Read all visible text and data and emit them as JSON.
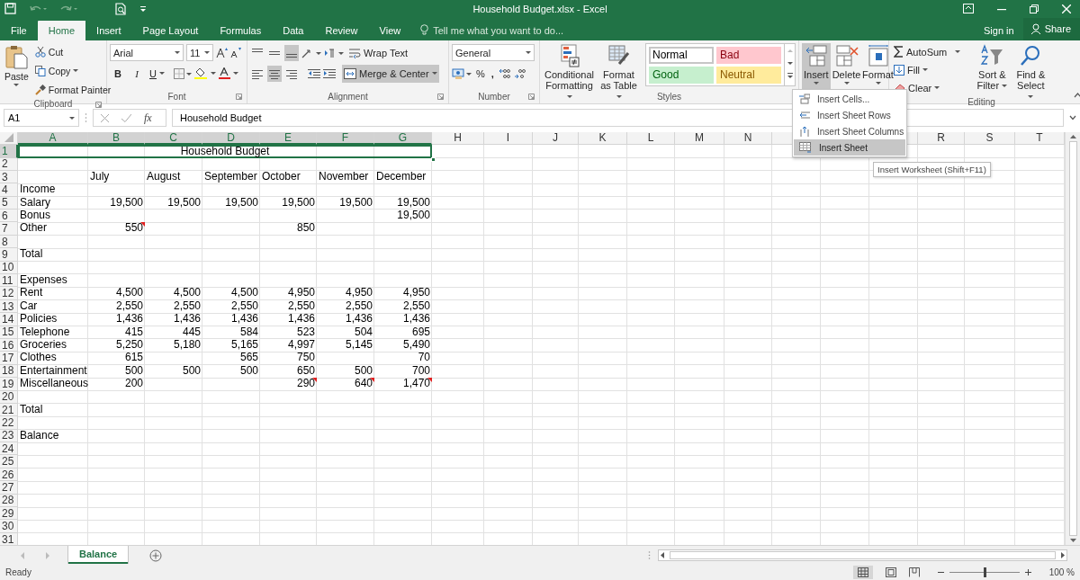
{
  "window": {
    "title": "Household Budget.xlsx - Excel"
  },
  "tabs": [
    {
      "label": "File",
      "selected": false
    },
    {
      "label": "Home",
      "selected": true
    },
    {
      "label": "Insert",
      "selected": false
    },
    {
      "label": "Page Layout",
      "selected": false
    },
    {
      "label": "Formulas",
      "selected": false
    },
    {
      "label": "Data",
      "selected": false
    },
    {
      "label": "Review",
      "selected": false
    },
    {
      "label": "View",
      "selected": false
    }
  ],
  "tell_me": {
    "placeholder": "Tell me what you want to do..."
  },
  "account": {
    "sign_in": "Sign in",
    "share": "Share"
  },
  "ribbon": {
    "clipboard": {
      "paste": "Paste",
      "cut": "Cut",
      "copy": "Copy",
      "format_painter": "Format Painter",
      "label": "Clipboard"
    },
    "font": {
      "name": "Arial",
      "size": "11",
      "bold": "B",
      "italic": "I",
      "underline": "U",
      "label": "Font"
    },
    "alignment": {
      "wrap_text": "Wrap Text",
      "merge_center": "Merge & Center",
      "label": "Alignment"
    },
    "number": {
      "format": "General",
      "percent": "%",
      "comma": ",",
      "label": "Number"
    },
    "styles": {
      "conditional_formatting": "Conditional Formatting",
      "format_as_table": "Format as Table",
      "cell_styles": [
        {
          "name": "Normal",
          "color": "#ffffff"
        },
        {
          "name": "Bad",
          "color": "#ffc7ce"
        },
        {
          "name": "Good",
          "color": "#c6efce"
        },
        {
          "name": "Neutral",
          "color": "#ffeb9c"
        }
      ],
      "label": "Styles"
    },
    "cells": {
      "buttons": [
        {
          "label": "Insert",
          "selected": true
        },
        {
          "label": "Delete",
          "selected": false
        },
        {
          "label": "Format",
          "selected": false
        }
      ]
    },
    "editing": {
      "autosum": "AutoSum",
      "fill": "Fill",
      "clear": "Clear",
      "sort_filter": "Sort & Filter",
      "find_select": "Find & Select",
      "label": "Editing"
    }
  },
  "formula_bar": {
    "name_box": "A1",
    "fx": "fx",
    "formula": "Household Budget"
  },
  "insert_menu": {
    "items": [
      {
        "label": "Insert Cells...",
        "selected": false
      },
      {
        "label": "Insert Sheet Rows",
        "selected": false
      },
      {
        "label": "Insert Sheet Columns",
        "selected": false
      },
      {
        "label": "Insert Sheet",
        "selected": true
      }
    ]
  },
  "tooltip": "Insert Worksheet (Shift+F11)",
  "grid": {
    "columns": [
      {
        "label": "A",
        "selected": true
      },
      {
        "label": "B",
        "selected": true
      },
      {
        "label": "C",
        "selected": true
      },
      {
        "label": "D",
        "selected": true
      },
      {
        "label": "E",
        "selected": true
      },
      {
        "label": "F",
        "selected": true
      },
      {
        "label": "G",
        "selected": true
      },
      {
        "label": "H",
        "selected": false
      },
      {
        "label": "I",
        "selected": false
      },
      {
        "label": "J",
        "selected": false
      },
      {
        "label": "K",
        "selected": false
      },
      {
        "label": "L",
        "selected": false
      },
      {
        "label": "M",
        "selected": false
      },
      {
        "label": "N",
        "selected": false
      }
    ],
    "columns_right": [
      {
        "label": "R",
        "selected": false
      },
      {
        "label": "S",
        "selected": false
      },
      {
        "label": "T",
        "selected": false
      }
    ],
    "rows": [
      {
        "number": "1",
        "selected": true,
        "kind": "title",
        "cells": {
          "a": {
            "text": "Household Budget",
            "comment": false
          }
        }
      },
      {
        "number": "2",
        "selected": false,
        "kind": "data"
      },
      {
        "number": "3",
        "selected": false,
        "kind": "months",
        "cells": {
          "b": {
            "text": "July",
            "comment": false
          },
          "c": {
            "text": "August",
            "comment": false
          },
          "d": {
            "text": "September",
            "comment": false
          },
          "e": {
            "text": "October",
            "comment": false
          },
          "f": {
            "text": "November",
            "comment": false
          },
          "g": {
            "text": "December",
            "comment": false
          }
        }
      },
      {
        "number": "4",
        "selected": false,
        "kind": "data",
        "cells": {
          "a": {
            "text": "Income",
            "comment": false
          }
        }
      },
      {
        "number": "5",
        "selected": false,
        "kind": "data",
        "cells": {
          "a": {
            "text": "Salary",
            "comment": false
          },
          "b": {
            "text": "19,500",
            "comment": false
          },
          "c": {
            "text": "19,500",
            "comment": false
          },
          "d": {
            "text": "19,500",
            "comment": false
          },
          "e": {
            "text": "19,500",
            "comment": false
          },
          "f": {
            "text": "19,500",
            "comment": false
          },
          "g": {
            "text": "19,500",
            "comment": false
          }
        }
      },
      {
        "number": "6",
        "selected": false,
        "kind": "data",
        "cells": {
          "a": {
            "text": "Bonus",
            "comment": false
          },
          "g": {
            "text": "19,500",
            "comment": false
          }
        }
      },
      {
        "number": "7",
        "selected": false,
        "kind": "data",
        "cells": {
          "a": {
            "text": "Other",
            "comment": false
          },
          "b": {
            "text": "550",
            "comment": true
          },
          "e": {
            "text": "850",
            "comment": false
          }
        }
      },
      {
        "number": "8",
        "selected": false,
        "kind": "data"
      },
      {
        "number": "9",
        "selected": false,
        "kind": "data",
        "cells": {
          "a": {
            "text": "Total",
            "comment": false
          }
        }
      },
      {
        "number": "10",
        "selected": false,
        "kind": "data"
      },
      {
        "number": "11",
        "selected": false,
        "kind": "data",
        "cells": {
          "a": {
            "text": "Expenses",
            "comment": false
          }
        }
      },
      {
        "number": "12",
        "selected": false,
        "kind": "data",
        "cells": {
          "a": {
            "text": "Rent",
            "comment": false
          },
          "b": {
            "text": "4,500",
            "comment": false
          },
          "c": {
            "text": "4,500",
            "comment": false
          },
          "d": {
            "text": "4,500",
            "comment": false
          },
          "e": {
            "text": "4,950",
            "comment": false
          },
          "f": {
            "text": "4,950",
            "comment": false
          },
          "g": {
            "text": "4,950",
            "comment": false
          }
        }
      },
      {
        "number": "13",
        "selected": false,
        "kind": "data",
        "cells": {
          "a": {
            "text": "Car",
            "comment": false
          },
          "b": {
            "text": "2,550",
            "comment": false
          },
          "c": {
            "text": "2,550",
            "comment": false
          },
          "d": {
            "text": "2,550",
            "comment": false
          },
          "e": {
            "text": "2,550",
            "comment": false
          },
          "f": {
            "text": "2,550",
            "comment": false
          },
          "g": {
            "text": "2,550",
            "comment": false
          }
        }
      },
      {
        "number": "14",
        "selected": false,
        "kind": "data",
        "cells": {
          "a": {
            "text": "Policies",
            "comment": false
          },
          "b": {
            "text": "1,436",
            "comment": false
          },
          "c": {
            "text": "1,436",
            "comment": false
          },
          "d": {
            "text": "1,436",
            "comment": false
          },
          "e": {
            "text": "1,436",
            "comment": false
          },
          "f": {
            "text": "1,436",
            "comment": false
          },
          "g": {
            "text": "1,436",
            "comment": false
          }
        }
      },
      {
        "number": "15",
        "selected": false,
        "kind": "data",
        "cells": {
          "a": {
            "text": "Telephone",
            "comment": false
          },
          "b": {
            "text": "415",
            "comment": false
          },
          "c": {
            "text": "445",
            "comment": false
          },
          "d": {
            "text": "584",
            "comment": false
          },
          "e": {
            "text": "523",
            "comment": false
          },
          "f": {
            "text": "504",
            "comment": false
          },
          "g": {
            "text": "695",
            "comment": false
          }
        }
      },
      {
        "number": "16",
        "selected": false,
        "kind": "data",
        "cells": {
          "a": {
            "text": "Groceries",
            "comment": false
          },
          "b": {
            "text": "5,250",
            "comment": false
          },
          "c": {
            "text": "5,180",
            "comment": false
          },
          "d": {
            "text": "5,165",
            "comment": false
          },
          "e": {
            "text": "4,997",
            "comment": false
          },
          "f": {
            "text": "5,145",
            "comment": false
          },
          "g": {
            "text": "5,490",
            "comment": false
          }
        }
      },
      {
        "number": "17",
        "selected": false,
        "kind": "data",
        "cells": {
          "a": {
            "text": "Clothes",
            "comment": false
          },
          "b": {
            "text": "615",
            "comment": false
          },
          "d": {
            "text": "565",
            "comment": false
          },
          "e": {
            "text": "750",
            "comment": false
          },
          "g": {
            "text": "70",
            "comment": false
          }
        }
      },
      {
        "number": "18",
        "selected": false,
        "kind": "data",
        "cells": {
          "a": {
            "text": "Entertainment",
            "comment": false
          },
          "b": {
            "text": "500",
            "comment": false
          },
          "c": {
            "text": "500",
            "comment": false
          },
          "d": {
            "text": "500",
            "comment": false
          },
          "e": {
            "text": "650",
            "comment": false
          },
          "f": {
            "text": "500",
            "comment": false
          },
          "g": {
            "text": "700",
            "comment": false
          }
        }
      },
      {
        "number": "19",
        "selected": false,
        "kind": "data",
        "cells": {
          "a": {
            "text": "Miscellaneous",
            "comment": false
          },
          "b": {
            "text": "200",
            "comment": false
          },
          "e": {
            "text": "290",
            "comment": true
          },
          "f": {
            "text": "640",
            "comment": true
          },
          "g": {
            "text": "1,470",
            "comment": true
          }
        }
      },
      {
        "number": "20",
        "selected": false,
        "kind": "data"
      },
      {
        "number": "21",
        "selected": false,
        "kind": "data",
        "cells": {
          "a": {
            "text": "Total",
            "comment": false
          }
        }
      },
      {
        "number": "22",
        "selected": false,
        "kind": "data"
      },
      {
        "number": "23",
        "selected": false,
        "kind": "data",
        "cells": {
          "a": {
            "text": "Balance",
            "comment": false
          }
        }
      },
      {
        "number": "24",
        "selected": false,
        "kind": "data"
      },
      {
        "number": "25",
        "selected": false,
        "kind": "data"
      },
      {
        "number": "26",
        "selected": false,
        "kind": "data"
      },
      {
        "number": "27",
        "selected": false,
        "kind": "data"
      },
      {
        "number": "28",
        "selected": false,
        "kind": "data"
      },
      {
        "number": "29",
        "selected": false,
        "kind": "data"
      },
      {
        "number": "30",
        "selected": false,
        "kind": "data"
      },
      {
        "number": "31",
        "selected": false,
        "kind": "data"
      }
    ]
  },
  "sheet_tabs": [
    {
      "label": "Balance",
      "selected": true
    }
  ],
  "status_bar": {
    "status": "Ready",
    "zoom": "100 %",
    "zoom_slider": {
      "level": 0.5
    }
  }
}
